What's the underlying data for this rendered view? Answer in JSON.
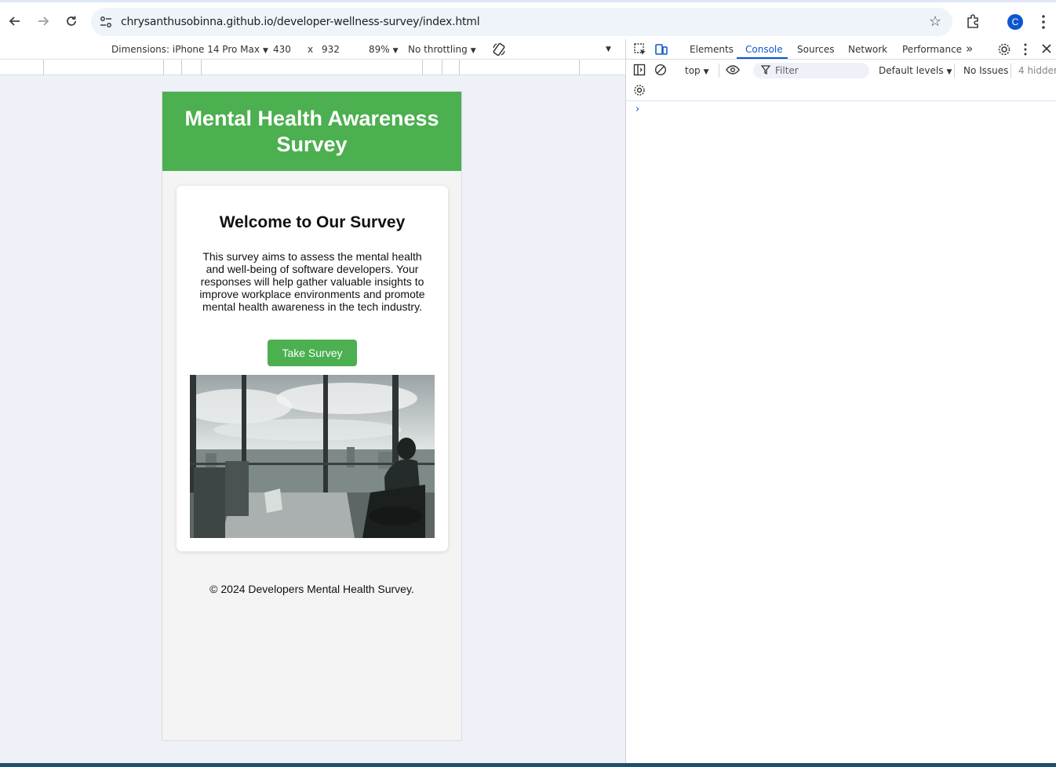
{
  "browser": {
    "url": "chrysanthusobinna.github.io/developer-wellness-survey/index.html",
    "avatar_letter": "C"
  },
  "device_toolbar": {
    "dimensions_label": "Dimensions: iPhone 14 Pro Max",
    "width": "430",
    "times": "x",
    "height": "932",
    "zoom": "89%",
    "throttling": "No throttling"
  },
  "page": {
    "header_title": "Mental Health Awareness Survey",
    "welcome_heading": "Welcome to Our Survey",
    "intro_text": "This survey aims to assess the mental health and well-being of software developers. Your responses will help gather valuable insights to improve workplace environments and promote mental health awareness in the tech industry.",
    "cta_label": "Take Survey",
    "footer": "© 2024 Developers Mental Health Survey.",
    "accent_color": "#4caf50"
  },
  "devtools": {
    "tabs": [
      "Elements",
      "Console",
      "Sources",
      "Network",
      "Performance"
    ],
    "active_tab": "Console",
    "context": "top",
    "filter_placeholder": "Filter",
    "levels": "Default levels",
    "issues": "No Issues",
    "hidden": "4 hidden",
    "prompt": "›"
  }
}
